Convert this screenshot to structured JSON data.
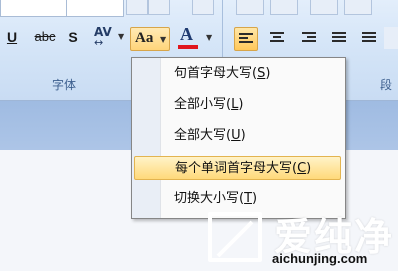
{
  "ribbon": {
    "format_buttons": [
      "U",
      "abc",
      "S"
    ],
    "char_spacing_label": "AV",
    "change_case_label": "Aa",
    "font_color_label": "A",
    "group_labels": [
      "字体",
      "段"
    ]
  },
  "menu": {
    "items": [
      {
        "label": "句首字母大写(",
        "key": "S",
        "end": ")"
      },
      {
        "label": "全部小写(",
        "key": "L",
        "end": ")"
      },
      {
        "label": "全部大写(",
        "key": "U",
        "end": ")"
      },
      {
        "label": "每个单词首字母大写(",
        "key": "C",
        "end": ")"
      },
      {
        "label": "切换大小写(",
        "key": "T",
        "end": ")"
      }
    ],
    "highlighted_index": 3
  },
  "watermark": {
    "text": "爱纯净",
    "url": "aichunjing.com"
  },
  "colors": {
    "font_color_bar": "#e0161d",
    "highlight": "#ffd97a"
  }
}
